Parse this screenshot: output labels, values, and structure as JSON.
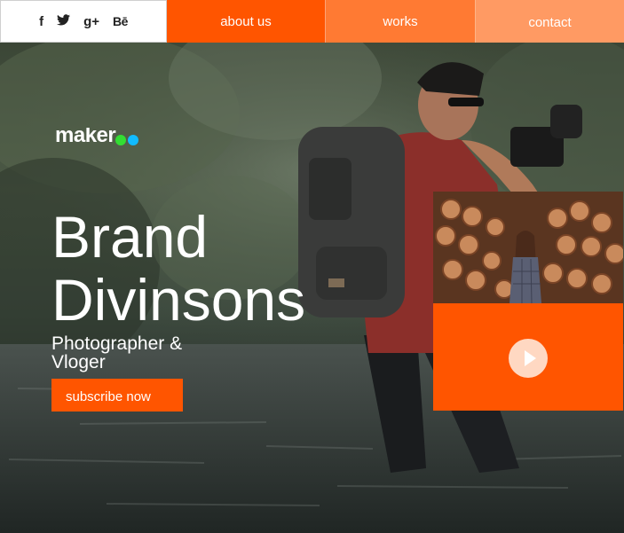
{
  "social": {
    "facebook": "f",
    "twitter": "🐦",
    "googleplus": "g+",
    "behance": "Bē"
  },
  "nav": {
    "about": "about us",
    "works": "works",
    "contact": "contact"
  },
  "logo": {
    "text": "maker",
    "dot_colors": [
      "#33dd33",
      "#11bbff"
    ]
  },
  "hero": {
    "title_line1": "Brand",
    "title_line2": "Divinsons",
    "subtitle_line1": "Photographer &",
    "subtitle_line2": "Vloger",
    "cta": "subscribe now"
  },
  "colors": {
    "accent": "#ff5500",
    "works_tab": "#ff7a33",
    "contact_tab": "#ff9a63"
  },
  "card": {
    "play_icon": "play-icon"
  }
}
